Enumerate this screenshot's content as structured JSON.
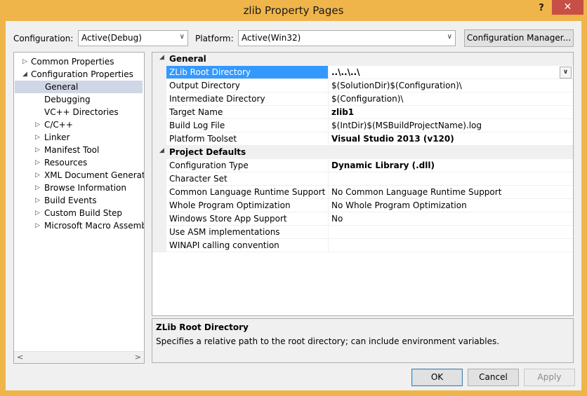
{
  "window": {
    "title": "zlib Property Pages",
    "help": "?",
    "close": "✕"
  },
  "config": {
    "label": "Configuration:",
    "value": "Active(Debug)",
    "platform_label": "Platform:",
    "platform_value": "Active(Win32)",
    "manager_button": "Configuration Manager..."
  },
  "tree": {
    "items": [
      {
        "label": "Common Properties",
        "level": 0,
        "toggle": "▷"
      },
      {
        "label": "Configuration Properties",
        "level": 0,
        "toggle": "◢"
      },
      {
        "label": "General",
        "level": 2,
        "toggle": "",
        "selected": true
      },
      {
        "label": "Debugging",
        "level": 2,
        "toggle": ""
      },
      {
        "label": "VC++ Directories",
        "level": 2,
        "toggle": ""
      },
      {
        "label": "C/C++",
        "level": 1,
        "toggle": "▷"
      },
      {
        "label": "Linker",
        "level": 1,
        "toggle": "▷"
      },
      {
        "label": "Manifest Tool",
        "level": 1,
        "toggle": "▷"
      },
      {
        "label": "Resources",
        "level": 1,
        "toggle": "▷"
      },
      {
        "label": "XML Document Generator",
        "level": 1,
        "toggle": "▷"
      },
      {
        "label": "Browse Information",
        "level": 1,
        "toggle": "▷"
      },
      {
        "label": "Build Events",
        "level": 1,
        "toggle": "▷"
      },
      {
        "label": "Custom Build Step",
        "level": 1,
        "toggle": "▷"
      },
      {
        "label": "Microsoft Macro Assemble",
        "level": 1,
        "toggle": "▷"
      }
    ]
  },
  "grid": {
    "rows": [
      {
        "type": "category",
        "name": "General",
        "caret": "◢"
      },
      {
        "type": "prop",
        "name": "ZLib Root Directory",
        "value": "..\\..\\..\\",
        "bold": true,
        "selected": true
      },
      {
        "type": "prop",
        "name": "Output Directory",
        "value": "$(SolutionDir)$(Configuration)\\",
        "bold": false
      },
      {
        "type": "prop",
        "name": "Intermediate Directory",
        "value": "$(Configuration)\\",
        "bold": false
      },
      {
        "type": "prop",
        "name": "Target Name",
        "value": "zlib1",
        "bold": true
      },
      {
        "type": "prop",
        "name": "Build Log File",
        "value": "$(IntDir)$(MSBuildProjectName).log",
        "bold": false
      },
      {
        "type": "prop",
        "name": "Platform Toolset",
        "value": "Visual Studio 2013 (v120)",
        "bold": true
      },
      {
        "type": "category",
        "name": "Project Defaults",
        "caret": "◢"
      },
      {
        "type": "prop",
        "name": "Configuration Type",
        "value": "Dynamic Library (.dll)",
        "bold": true
      },
      {
        "type": "prop",
        "name": "Character Set",
        "value": "",
        "bold": false
      },
      {
        "type": "prop",
        "name": "Common Language Runtime Support",
        "value": "No Common Language Runtime Support",
        "bold": false
      },
      {
        "type": "prop",
        "name": "Whole Program Optimization",
        "value": "No Whole Program Optimization",
        "bold": false
      },
      {
        "type": "prop",
        "name": "Windows Store App Support",
        "value": "No",
        "bold": false
      },
      {
        "type": "prop",
        "name": "Use ASM implementations",
        "value": "",
        "bold": false
      },
      {
        "type": "prop",
        "name": "WINAPI calling convention",
        "value": "",
        "bold": false
      }
    ]
  },
  "description": {
    "title": "ZLib Root Directory",
    "text": "Specifies a relative path to the root directory; can include environment variables."
  },
  "buttons": {
    "ok": "OK",
    "cancel": "Cancel",
    "apply": "Apply"
  }
}
